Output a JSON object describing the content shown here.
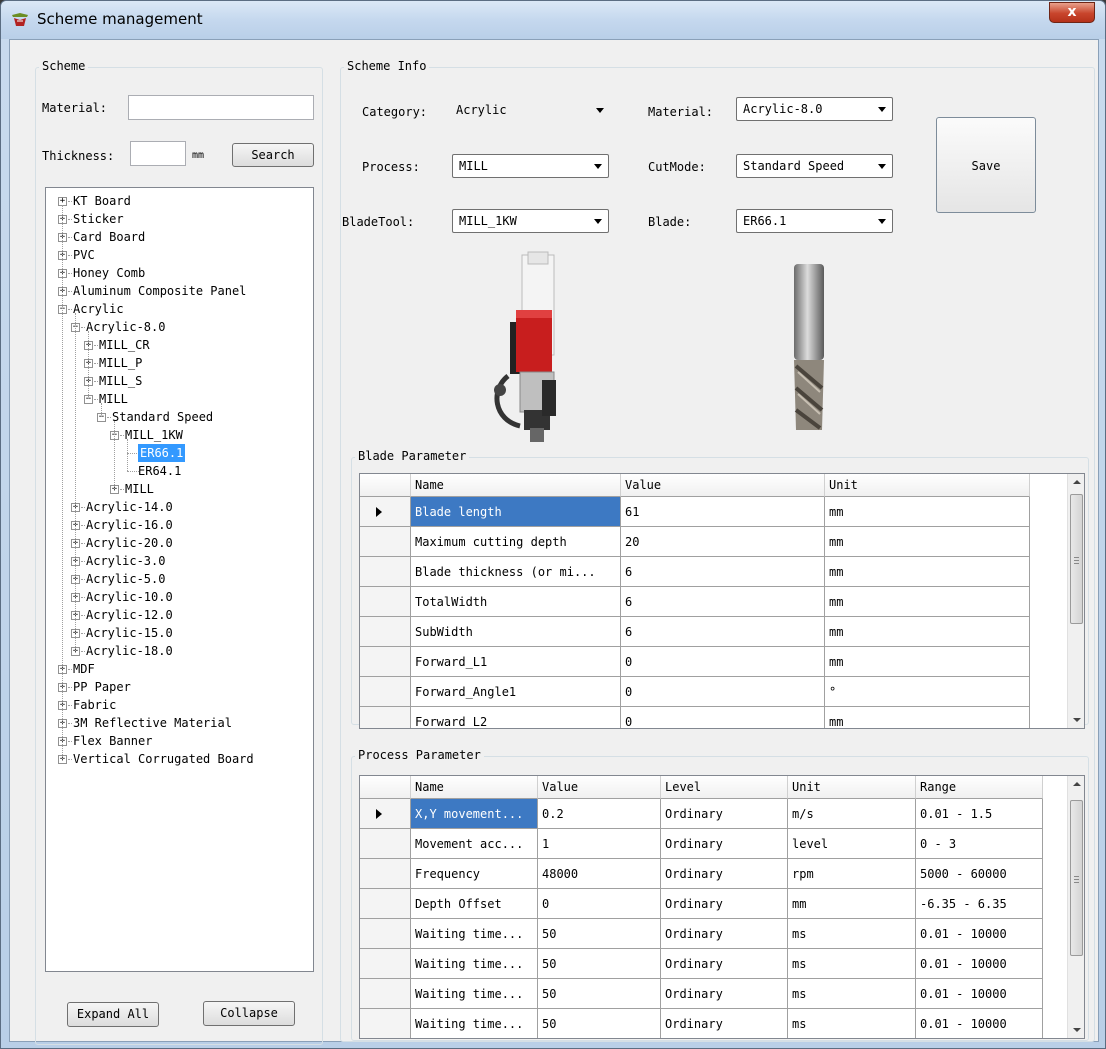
{
  "window": {
    "title": "Scheme management",
    "close_glyph": "x"
  },
  "scheme": {
    "legend": "Scheme",
    "material_label": "Material:",
    "material_value": "",
    "thickness_label": "Thickness:",
    "thickness_value": "",
    "thickness_unit": "mm",
    "search_label": "Search",
    "expand_all_label": "Expand All",
    "collapse_label": "Collapse"
  },
  "tree": {
    "nodes": [
      {
        "label": "KT Board",
        "level": 0,
        "state": "collapsed"
      },
      {
        "label": "Sticker",
        "level": 0,
        "state": "collapsed"
      },
      {
        "label": "Card Board",
        "level": 0,
        "state": "collapsed"
      },
      {
        "label": "PVC",
        "level": 0,
        "state": "collapsed"
      },
      {
        "label": "Honey Comb",
        "level": 0,
        "state": "collapsed"
      },
      {
        "label": "Aluminum Composite Panel",
        "level": 0,
        "state": "collapsed"
      },
      {
        "label": "Acrylic",
        "level": 0,
        "state": "expanded"
      },
      {
        "label": "Acrylic-8.0",
        "level": 1,
        "state": "expanded"
      },
      {
        "label": "MILL_CR",
        "level": 2,
        "state": "collapsed"
      },
      {
        "label": "MILL_P",
        "level": 2,
        "state": "collapsed"
      },
      {
        "label": "MILL_S",
        "level": 2,
        "state": "collapsed"
      },
      {
        "label": "MILL",
        "level": 2,
        "state": "expanded"
      },
      {
        "label": "Standard Speed",
        "level": 3,
        "state": "expanded"
      },
      {
        "label": "MILL_1KW",
        "level": 4,
        "state": "expanded"
      },
      {
        "label": "ER66.1",
        "level": 5,
        "state": "leaf",
        "selected": true
      },
      {
        "label": "ER64.1",
        "level": 5,
        "state": "leaf"
      },
      {
        "label": "MILL",
        "level": 4,
        "state": "collapsed"
      },
      {
        "label": "Acrylic-14.0",
        "level": 1,
        "state": "collapsed"
      },
      {
        "label": "Acrylic-16.0",
        "level": 1,
        "state": "collapsed"
      },
      {
        "label": "Acrylic-20.0",
        "level": 1,
        "state": "collapsed"
      },
      {
        "label": "Acrylic-3.0",
        "level": 1,
        "state": "collapsed"
      },
      {
        "label": "Acrylic-5.0",
        "level": 1,
        "state": "collapsed"
      },
      {
        "label": "Acrylic-10.0",
        "level": 1,
        "state": "collapsed"
      },
      {
        "label": "Acrylic-12.0",
        "level": 1,
        "state": "collapsed"
      },
      {
        "label": "Acrylic-15.0",
        "level": 1,
        "state": "collapsed"
      },
      {
        "label": "Acrylic-18.0",
        "level": 1,
        "state": "collapsed"
      },
      {
        "label": "MDF",
        "level": 0,
        "state": "collapsed"
      },
      {
        "label": "PP Paper",
        "level": 0,
        "state": "collapsed"
      },
      {
        "label": "Fabric",
        "level": 0,
        "state": "collapsed"
      },
      {
        "label": "3M Reflective Material",
        "level": 0,
        "state": "collapsed"
      },
      {
        "label": "Flex Banner",
        "level": 0,
        "state": "collapsed"
      },
      {
        "label": "Vertical Corrugated Board",
        "level": 0,
        "state": "collapsed"
      }
    ]
  },
  "info": {
    "legend": "Scheme Info",
    "category_label": "Category:",
    "category_value": "Acrylic",
    "material_label": "Material:",
    "material_value": "Acrylic-8.0",
    "process_label": "Process:",
    "process_value": "MILL",
    "cutmode_label": "CutMode:",
    "cutmode_value": "Standard Speed",
    "bladetool_label": "BladeTool:",
    "bladetool_value": "MILL_1KW",
    "blade_label": "Blade:",
    "blade_value": "ER66.1",
    "save_label": "Save"
  },
  "blade_param": {
    "legend": "Blade Parameter",
    "columns": [
      "Name",
      "Value",
      "Unit"
    ],
    "rows": [
      [
        "Blade length",
        "61",
        "mm"
      ],
      [
        "Maximum cutting depth",
        "20",
        "mm"
      ],
      [
        "Blade thickness (or mi...",
        "6",
        "mm"
      ],
      [
        "TotalWidth",
        "6",
        "mm"
      ],
      [
        "SubWidth",
        "6",
        "mm"
      ],
      [
        "Forward_L1",
        "0",
        "mm"
      ],
      [
        "Forward_Angle1",
        "0",
        "°"
      ],
      [
        "Forward_L2",
        "0",
        "mm"
      ]
    ]
  },
  "process_param": {
    "legend": "Process Parameter",
    "columns": [
      "Name",
      "Value",
      "Level",
      "Unit",
      "Range"
    ],
    "rows": [
      [
        "X,Y movement...",
        "0.2",
        "Ordinary",
        "m/s",
        "0.01 - 1.5"
      ],
      [
        "Movement acc...",
        "1",
        "Ordinary",
        "level",
        "0 - 3"
      ],
      [
        "Frequency",
        "48000",
        "Ordinary",
        "rpm",
        "5000 - 60000"
      ],
      [
        "Depth Offset",
        "0",
        "Ordinary",
        "mm",
        "-6.35 - 6.35"
      ],
      [
        "Waiting time...",
        "50",
        "Ordinary",
        "ms",
        "0.01 - 10000"
      ],
      [
        "Waiting time...",
        "50",
        "Ordinary",
        "ms",
        "0.01 - 10000"
      ],
      [
        "Waiting time...",
        "50",
        "Ordinary",
        "ms",
        "0.01 - 10000"
      ],
      [
        "Waiting time...",
        "50",
        "Ordinary",
        "ms",
        "0.01 - 10000"
      ]
    ]
  },
  "colors": {
    "selection": "#3399ff",
    "grid_selection": "#3d79c3",
    "close_button": "#c8452c"
  },
  "icons": [
    "app-icon",
    "close-icon",
    "dropdown-arrow-icon",
    "row-pointer-icon",
    "spindle-image",
    "endmill-image",
    "tree-expander-icon"
  ]
}
